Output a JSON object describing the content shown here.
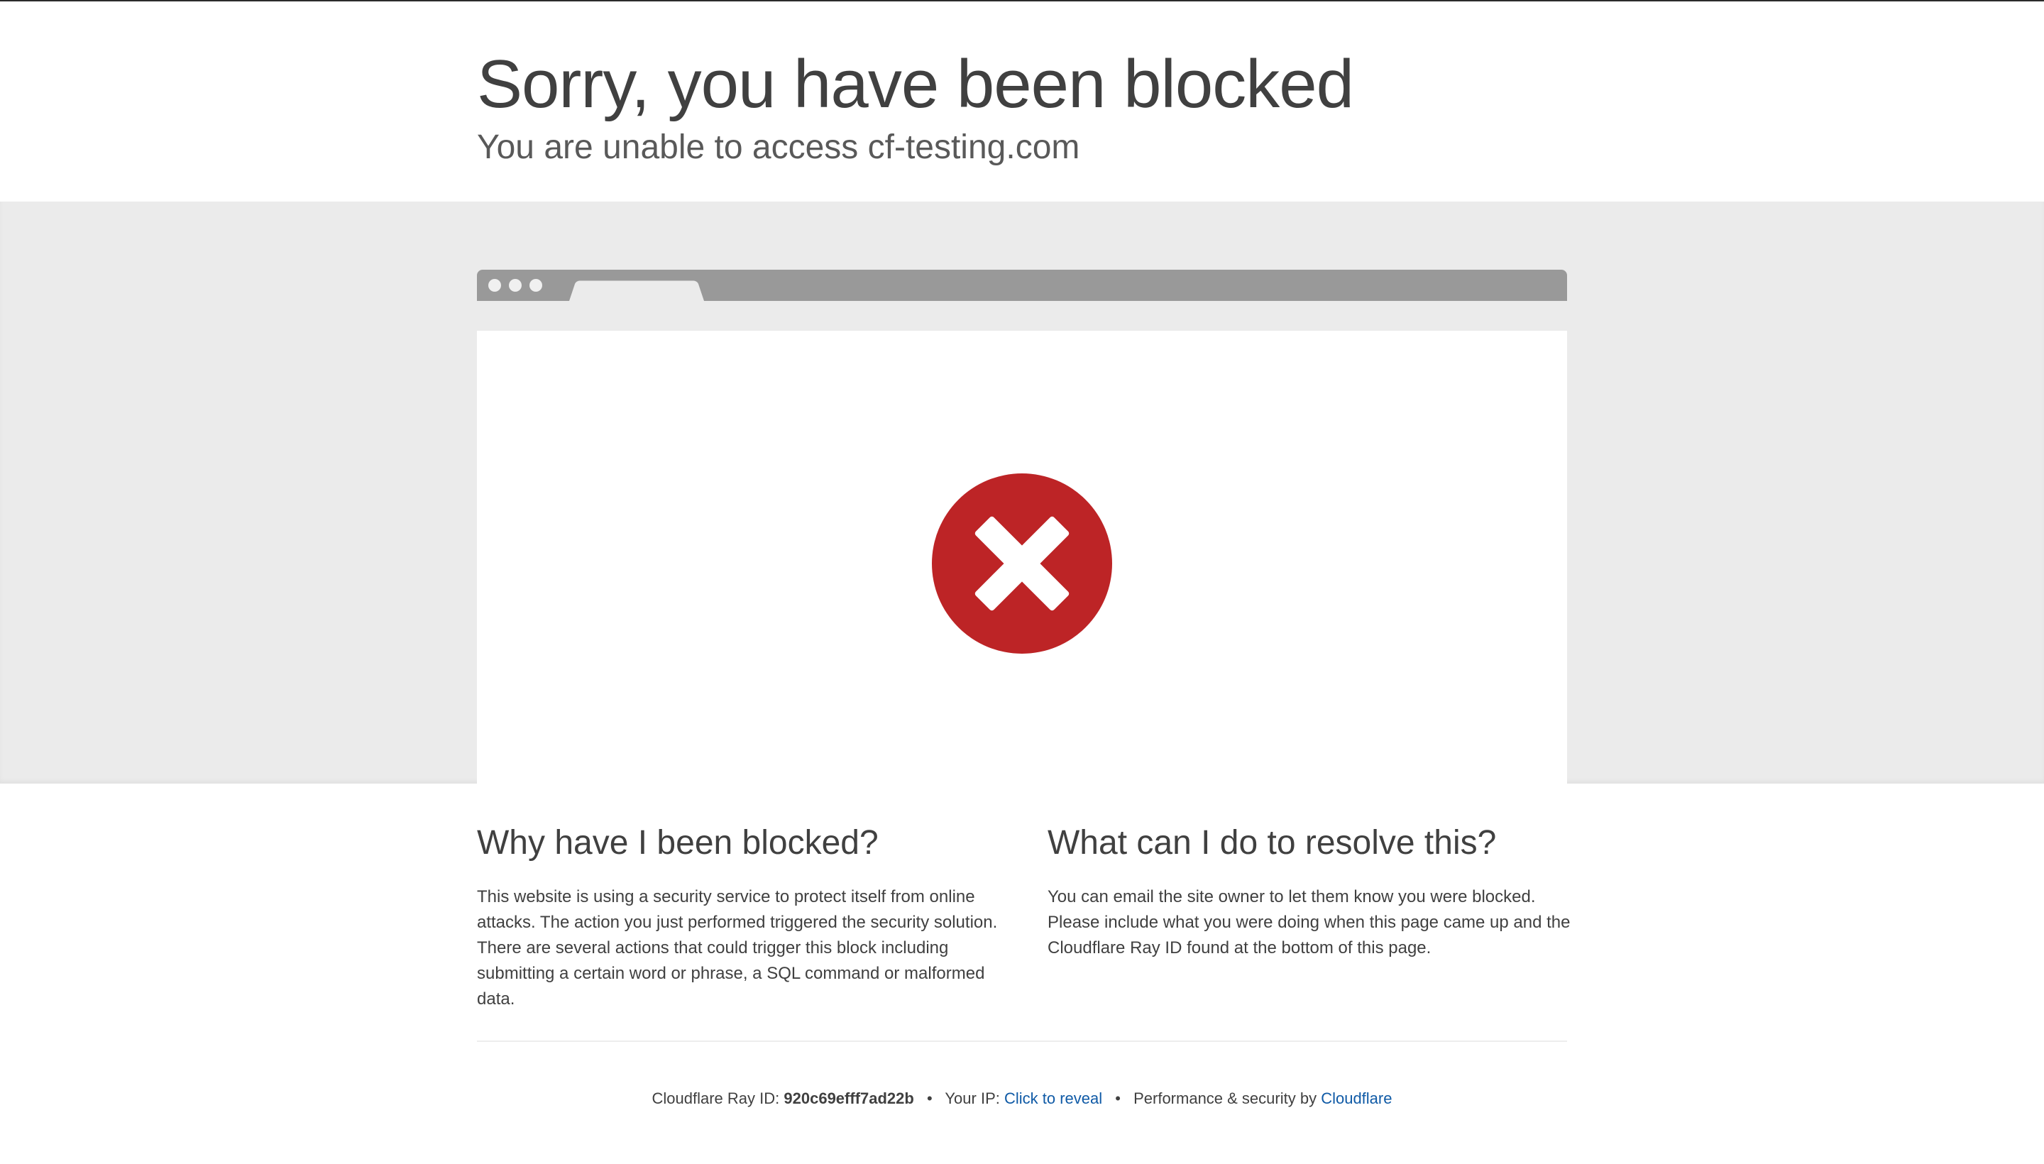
{
  "header": {
    "title": "Sorry, you have been blocked",
    "subtitle": "You are unable to access cf-testing.com"
  },
  "browser_illustration": {
    "icon": "block-x-icon",
    "icon_color": "#bd2426"
  },
  "sections": {
    "why": {
      "heading": "Why have I been blocked?",
      "text": "This website is using a security service to protect itself from online attacks. The action you just performed triggered the security solution. There are several actions that could trigger this block including submitting a certain word or phrase, a SQL command or malformed data."
    },
    "resolve": {
      "heading": "What can I do to resolve this?",
      "text": "You can email the site owner to let them know you were blocked. Please include what you were doing when this page came up and the Cloudflare Ray ID found at the bottom of this page."
    }
  },
  "footer": {
    "ray_label": "Cloudflare Ray ID:",
    "ray_id": "920c69efff7ad22b",
    "separator": "•",
    "ip_label": "Your IP:",
    "ip_reveal": "Click to reveal",
    "perf_label": "Performance & security by",
    "perf_link": "Cloudflare",
    "link_color": "#0f5aa6"
  }
}
